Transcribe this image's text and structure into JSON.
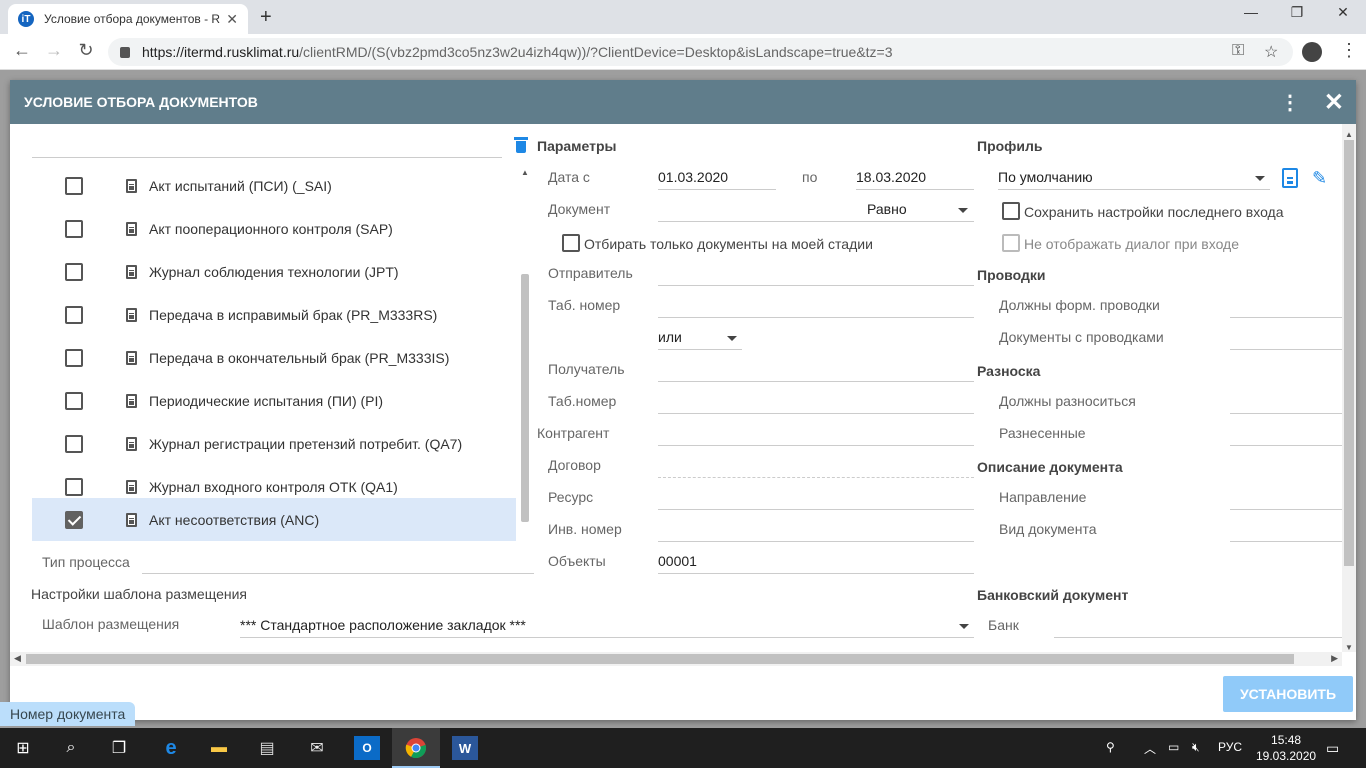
{
  "browser": {
    "tab_title": "Условие отбора документов - R",
    "favicon_text": "iT",
    "url_host": "https://itermd.rusklimat.ru",
    "url_rest": "/clientRMD/(S(vbz2pmd3co5nz3w2u4izh4qw))/?ClientDevice=Desktop&isLandscape=true&tz=3"
  },
  "dialog": {
    "title": "УСЛОВИЕ ОТБОРА ДОКУМЕНТОВ",
    "list_items": [
      {
        "label": "Акт испытаний (ПСИ) (_SAI)",
        "checked": false
      },
      {
        "label": "Акт пооперационного контроля (SAP)",
        "checked": false
      },
      {
        "label": "Журнал соблюдения технологии (JPT)",
        "checked": false
      },
      {
        "label": "Передача в исправимый брак (PR_M333RS)",
        "checked": false
      },
      {
        "label": "Передача в окончательный брак (PR_M333IS)",
        "checked": false
      },
      {
        "label": "Периодические испытания (ПИ) (PI)",
        "checked": false
      },
      {
        "label": "Журнал регистрации претензий потребит. (QA7)",
        "checked": false
      },
      {
        "label": "Журнал входного контроля ОТК (QA1)",
        "checked": false
      },
      {
        "label": "Акт несоответствия (ANC)",
        "checked": true
      }
    ],
    "process_type_label": "Тип процесса",
    "placement_section": "Настройки шаблона размещения",
    "placement_label": "Шаблон размещения",
    "placement_value": "*** Стандартное расположение закладок ***",
    "params": {
      "header": "Параметры",
      "date_from_label": "Дата с",
      "date_from": "01.03.2020",
      "date_to_label": "по",
      "date_to": "18.03.2020",
      "document_label": "Документ",
      "document_op": "Равно",
      "only_my_stage": "Отбирать только документы на моей стадии",
      "sender_label": "Отправитель",
      "tab_num_label": "Таб. номер",
      "or_value": "или",
      "recipient_label": "Получатель",
      "tab_num2_label": "Таб.номер",
      "counterparty_label": "Контрагент",
      "contract_label": "Договор",
      "resource_label": "Ресурс",
      "inv_num_label": "Инв. номер",
      "objects_label": "Объекты",
      "objects_value": "00001"
    },
    "profile": {
      "header": "Профиль",
      "value": "По умолчанию",
      "save_last": "Сохранить настройки последнего входа",
      "no_dialog": "Не отображать диалог при входе",
      "postings_header": "Проводки",
      "must_form_postings": "Должны форм. проводки",
      "docs_with_postings": "Документы с проводками",
      "posting_header": "Разноска",
      "must_be_posted": "Должны разноситься",
      "posted": "Разнесенные",
      "doc_desc_header": "Описание документа",
      "direction": "Направление",
      "doc_type": "Вид документа",
      "bank_doc_header": "Банковский документ",
      "bank": "Банк"
    },
    "apply_button": "УСТАНОВИТЬ",
    "doc_number_chip": "Номер документа"
  },
  "taskbar": {
    "lang": "РУС",
    "time": "15:48",
    "date": "19.03.2020"
  }
}
